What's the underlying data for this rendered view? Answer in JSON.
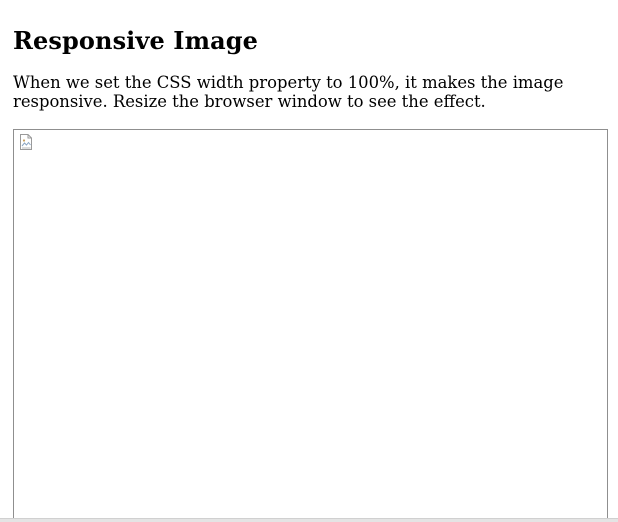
{
  "page": {
    "title": "Responsive Image",
    "description": "When we set the CSS width property to 100%, it makes the image responsive. Resize the browser window to see the effect."
  },
  "image": {
    "state": "broken",
    "icon": "broken-image-icon"
  },
  "colors": {
    "text": "#000000",
    "frame_border": "#8f8f8f",
    "background": "#ffffff"
  }
}
